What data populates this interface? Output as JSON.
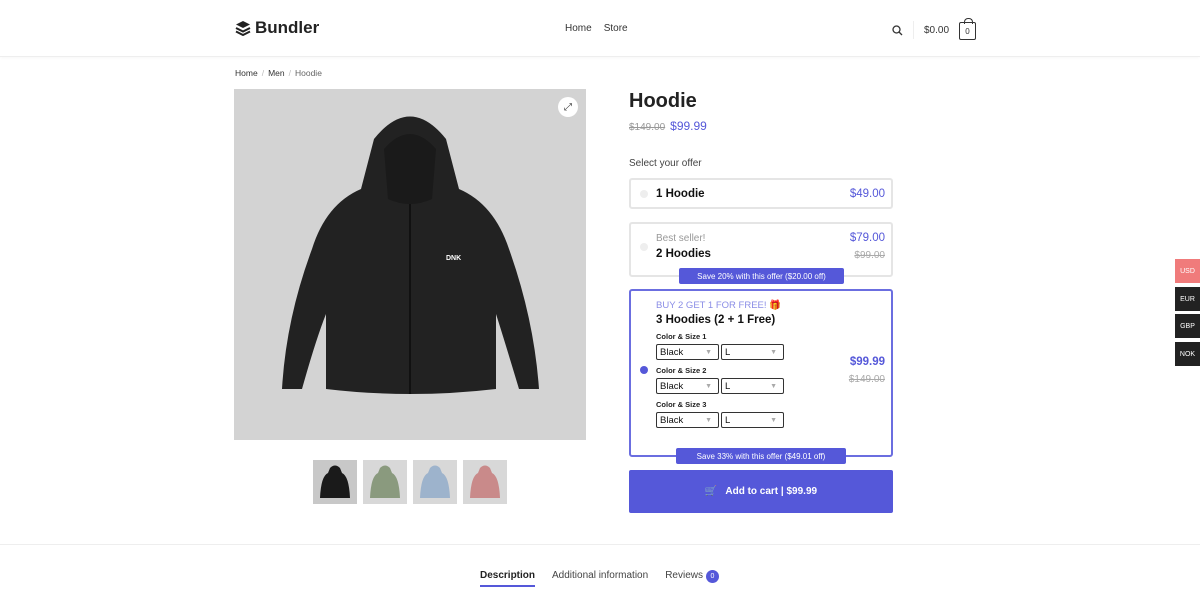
{
  "header": {
    "logo": "Bundler",
    "nav": [
      "Home",
      "Store"
    ],
    "cart_total": "$0.00",
    "cart_count": "0"
  },
  "breadcrumb": [
    "Home",
    "Men",
    "Hoodie"
  ],
  "product": {
    "title": "Hoodie",
    "old_price": "$149.00",
    "price": "$99.99",
    "thumbnail_colors": [
      "#1a1a1a",
      "#8a9a7e",
      "#9db3cc",
      "#c98a8a"
    ]
  },
  "offers": {
    "heading": "Select your offer",
    "items": [
      {
        "name": "1 Hoodie",
        "price": "$49.00"
      },
      {
        "tag": "Best seller!",
        "name": "2 Hoodies",
        "price": "$79.00",
        "old_price": "$99.00",
        "badge": "Save 20% with this offer ($20.00 off)"
      },
      {
        "tag": "BUY 2 GET 1 FOR FREE! 🎁",
        "name": "3 Hoodies (2 + 1 Free)",
        "price": "$99.99",
        "old_price": "$149.00",
        "badge": "Save 33% with this offer ($49.01 off)",
        "selected": true,
        "variants": [
          {
            "label": "Color & Size 1",
            "color": "Black",
            "size": "L"
          },
          {
            "label": "Color & Size 2",
            "color": "Black",
            "size": "L"
          },
          {
            "label": "Color & Size 3",
            "color": "Black",
            "size": "L"
          }
        ]
      }
    ]
  },
  "add_to_cart": "Add to cart | $99.99",
  "currencies": [
    {
      "code": "USD",
      "active": true
    },
    {
      "code": "EUR"
    },
    {
      "code": "GBP"
    },
    {
      "code": "NOK"
    }
  ],
  "tabs": [
    {
      "label": "Description",
      "active": true
    },
    {
      "label": "Additional information"
    },
    {
      "label": "Reviews",
      "count": "0"
    }
  ],
  "colors": {
    "accent": "#5558d9",
    "currency_active": "#f07b7b"
  }
}
